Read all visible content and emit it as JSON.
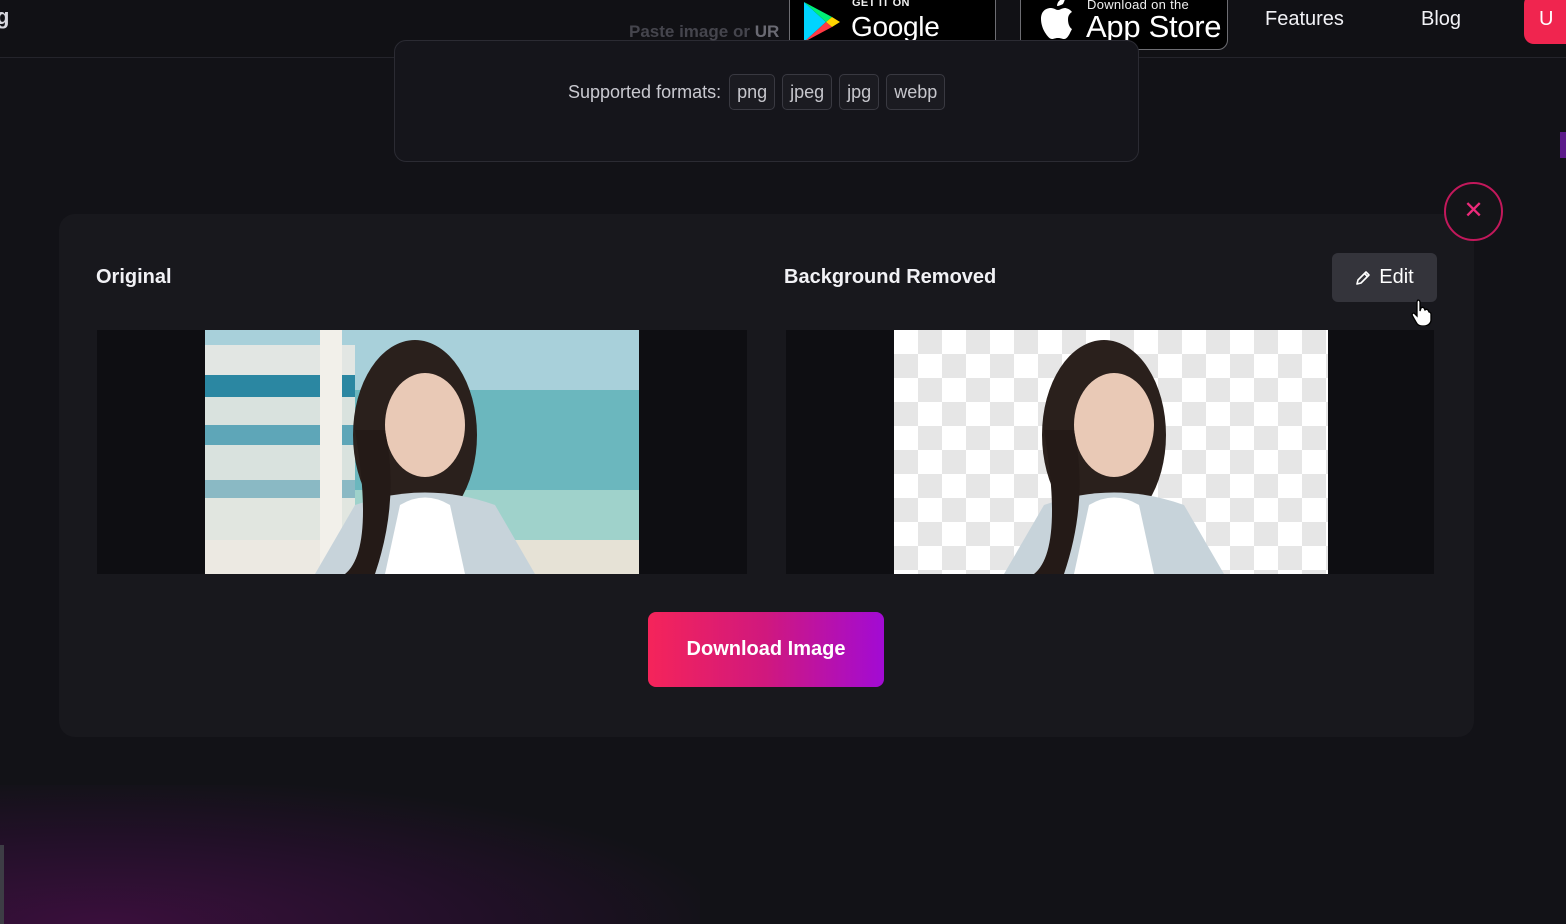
{
  "nav": {
    "logo_fragment": "g",
    "google_play": {
      "small": "GET IT ON",
      "big": "Google Play"
    },
    "app_store": {
      "small": "Download on the",
      "big": "App Store"
    },
    "links": [
      "Features",
      "Blog"
    ],
    "cta_fragment": "U"
  },
  "upload": {
    "paste_hint": "Paste image or",
    "paste_hint_url": "UR",
    "formats_label": "Supported formats:",
    "formats": [
      "png",
      "jpeg",
      "jpg",
      "webp"
    ]
  },
  "result": {
    "original_label": "Original",
    "removed_label": "Background Removed",
    "edit_label": "Edit",
    "close_symbol": "✕",
    "download_label": "Download Image"
  },
  "colors": {
    "background": "#121217",
    "accent_pink": "#f5245a",
    "accent_purple": "#a20bd4",
    "close_ring": "#c2185b"
  },
  "icons": [
    "google-play-icon",
    "apple-icon",
    "close-icon",
    "pencil-icon",
    "hand-cursor-icon"
  ]
}
